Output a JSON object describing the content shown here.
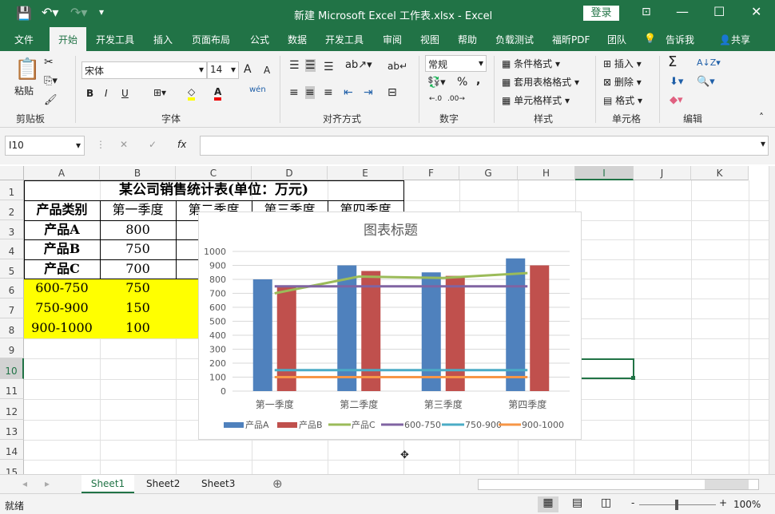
{
  "titlebar": {
    "title": "新建 Microsoft Excel 工作表.xlsx  -  Excel",
    "login": "登录"
  },
  "menu": [
    "文件",
    "开始",
    "开发工具",
    "插入",
    "页面布局",
    "公式",
    "数据",
    "开发工具",
    "审阅",
    "视图",
    "帮助",
    "负载测试",
    "福昕PDF",
    "团队",
    "告诉我",
    "共享"
  ],
  "ribbon": {
    "clipboard": {
      "paste": "粘贴",
      "label": "剪贴板"
    },
    "font": {
      "name": "宋体",
      "size": "14",
      "bold": "B",
      "italic": "I",
      "underline": "U",
      "grow": "A",
      "shrink": "A",
      "font_color": "A",
      "phonetic": "wén",
      "label": "字体"
    },
    "alignment": {
      "label": "对齐方式"
    },
    "number": {
      "format": "常规",
      "percent": "%",
      "comma": ",",
      "label": "数字"
    },
    "styles": {
      "conditional": "条件格式",
      "table": "套用表格格式",
      "cell": "单元格样式",
      "label": "样式"
    },
    "cells": {
      "insert": "插入",
      "delete": "删除",
      "format": "格式",
      "label": "单元格"
    },
    "editing": {
      "sum": "Σ",
      "label": "编辑"
    }
  },
  "formula_bar": {
    "name_box": "I10",
    "fx": "fx",
    "value": ""
  },
  "columns": [
    "A",
    "B",
    "C",
    "D",
    "E",
    "F",
    "G",
    "H",
    "I",
    "J",
    "K"
  ],
  "rows": [
    "1",
    "2",
    "3",
    "4",
    "5",
    "6",
    "7",
    "8",
    "9",
    "10",
    "11",
    "12",
    "13",
    "14",
    "15"
  ],
  "table": {
    "title": "某公司销售统计表(单位：万元)",
    "headers": [
      "产品类别",
      "第一季度",
      "第二季度",
      "第三季度",
      "第四季度"
    ],
    "body": [
      [
        "产品A",
        "800"
      ],
      [
        "产品B",
        "750"
      ],
      [
        "产品C",
        "700"
      ],
      [
        "600-750",
        "750"
      ],
      [
        "750-900",
        "150"
      ],
      [
        "900-1000",
        "100"
      ]
    ]
  },
  "colors": {
    "accent": "#217346",
    "highlight": "#ffff00"
  },
  "chart_data": {
    "type": "bar",
    "title": "图表标题",
    "categories": [
      "第一季度",
      "第二季度",
      "第三季度",
      "第四季度"
    ],
    "ylim": [
      0,
      1000
    ],
    "yticks": [
      "0",
      "100",
      "200",
      "300",
      "400",
      "500",
      "600",
      "700",
      "800",
      "900",
      "1000"
    ],
    "grid": true,
    "legend": "bottom",
    "series": [
      {
        "name": "产品A",
        "kind": "bar",
        "color": "#4f81bd",
        "values": [
          800,
          900,
          850,
          950
        ]
      },
      {
        "name": "产品B",
        "kind": "bar",
        "color": "#c0504d",
        "values": [
          750,
          860,
          825,
          900
        ]
      },
      {
        "name": "产品C",
        "kind": "line",
        "color": "#9bbb59",
        "values": [
          700,
          820,
          810,
          845
        ]
      },
      {
        "name": "600-750",
        "kind": "line",
        "color": "#8064a2",
        "values": [
          750,
          750,
          750,
          750
        ]
      },
      {
        "name": "750-900",
        "kind": "line",
        "color": "#4bacc6",
        "values": [
          150,
          150,
          150,
          150
        ]
      },
      {
        "name": "900-1000",
        "kind": "line",
        "color": "#f79646",
        "values": [
          100,
          100,
          100,
          100
        ]
      }
    ]
  },
  "sheets": [
    "Sheet1",
    "Sheet2",
    "Sheet3"
  ],
  "status": {
    "ready": "就绪",
    "zoom": "100%"
  }
}
